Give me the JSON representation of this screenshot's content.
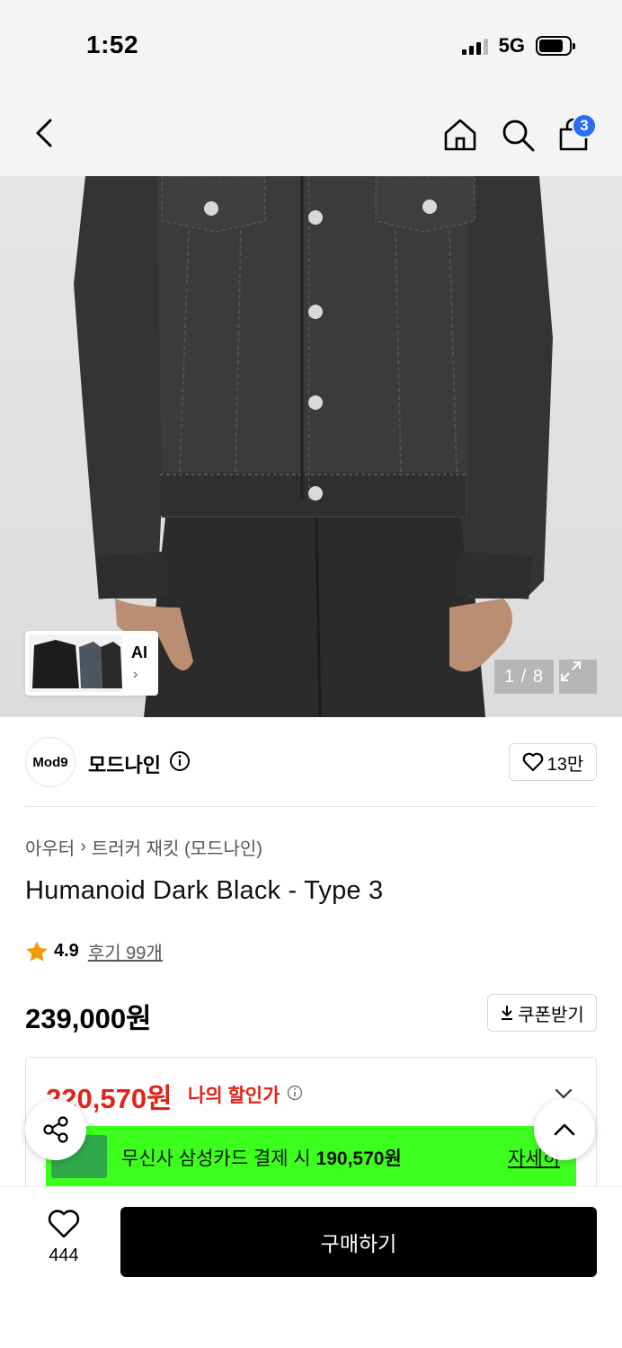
{
  "status_bar": {
    "time": "1:52",
    "network": "5G"
  },
  "nav": {
    "cart_count": "3"
  },
  "gallery": {
    "ai_label": "AI",
    "counter": "1 / 8"
  },
  "brand": {
    "logo_text": "Mod9",
    "name": "모드나인",
    "likes": "13만"
  },
  "breadcrumb": {
    "category": "아우터",
    "subcategory": "트러커 재킷 (모드나인)"
  },
  "product": {
    "title": "Humanoid Dark Black - Type 3",
    "rating": "4.9",
    "reviews": "후기 99개",
    "price": "239,000원",
    "coupon_label": "쿠폰받기"
  },
  "discount": {
    "price": "220,570원",
    "label": "나의 할인가",
    "promo_text": "무신사 삼성카드 결제 시",
    "promo_price": "190,570원",
    "promo_link": "자세히"
  },
  "bottom": {
    "wish_count": "444",
    "buy_label": "구매하기"
  },
  "colors": {
    "accent_red": "#e2231a",
    "promo_green": "#3cff1e",
    "badge_blue": "#2a6cf6"
  }
}
